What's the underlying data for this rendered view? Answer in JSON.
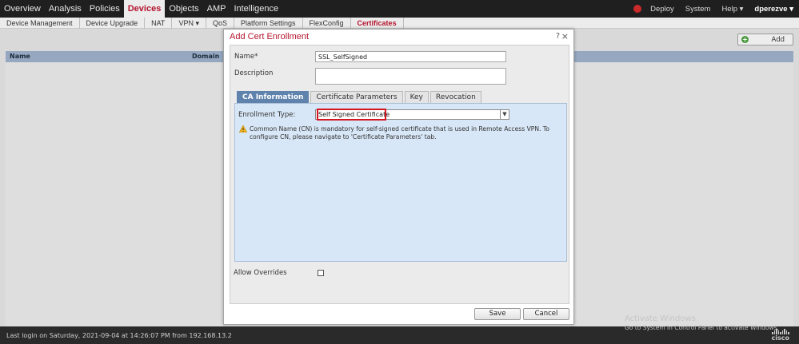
{
  "topnav": {
    "items": [
      "Overview",
      "Analysis",
      "Policies",
      "Devices",
      "Objects",
      "AMP",
      "Intelligence"
    ],
    "active_index": 3,
    "right": {
      "deploy": "Deploy",
      "system": "System",
      "help": "Help ▾",
      "user": "dperezve ▾"
    }
  },
  "subnav": {
    "items": [
      "Device Management",
      "Device Upgrade",
      "NAT",
      "VPN ▾",
      "QoS",
      "Platform Settings",
      "FlexConfig",
      "Certificates"
    ],
    "active_index": 7
  },
  "page": {
    "add_label": "Add",
    "columns": [
      "Name",
      "Domain"
    ]
  },
  "dialog": {
    "title": "Add Cert Enrollment",
    "help": "?",
    "close": "×",
    "name_label": "Name*",
    "name_value": "SSL_SelfSigned",
    "description_label": "Description",
    "description_value": "",
    "tabs": [
      "CA Information",
      "Certificate Parameters",
      "Key",
      "Revocation"
    ],
    "active_tab": 0,
    "enrollment_label": "Enrollment Type:",
    "enrollment_value": "Self Signed Certificate",
    "warning": "Common Name (CN) is mandatory for self-signed certificate that is used in Remote Access VPN. To configure CN, please navigate to 'Certificate Parameters' tab.",
    "allow_overrides_label": "Allow Overrides",
    "allow_overrides_checked": false,
    "save_label": "Save",
    "cancel_label": "Cancel"
  },
  "status": {
    "login": "Last login on Saturday, 2021-09-04 at 14:26:07 PM from 192.168.13.2",
    "brand": "cisco"
  },
  "watermark": {
    "title": "Activate Windows",
    "subtitle": "Go to System in Control Panel to activate Windows."
  },
  "colors": {
    "accent": "#b4142e",
    "tab_active": "#5f83ad",
    "panel": "#d8e7f7",
    "highlight": "#d3161f"
  }
}
